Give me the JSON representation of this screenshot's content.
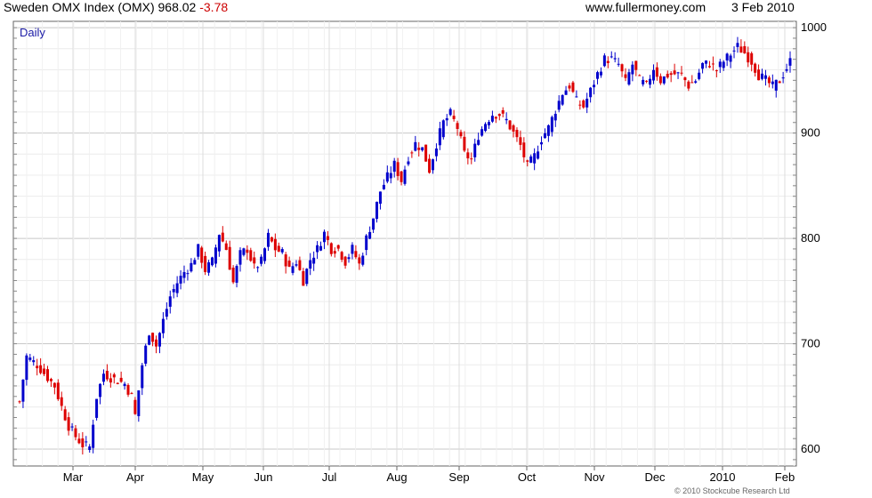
{
  "header": {
    "title": "Sweden OMX Index (OMX)",
    "last": "968.02",
    "change": "-3.78",
    "source": "www.fullermoney.com",
    "date": "3 Feb 2010"
  },
  "period_label": "Daily",
  "copyright": "© 2010 Stockcube Research Ltd",
  "colors": {
    "up": "#0000cc",
    "down": "#dd0000",
    "grid": "#dddddd",
    "frame": "#666666",
    "change": "#cc0000"
  },
  "chart_data": {
    "type": "ohlc",
    "y_axis": {
      "min": 584,
      "max": 1006,
      "ticks": [
        600,
        700,
        800,
        900,
        1000
      ],
      "position": "right"
    },
    "x_labels": [
      "Mar",
      "Apr",
      "May",
      "Jun",
      "Jul",
      "Aug",
      "Sep",
      "Oct",
      "Nov",
      "Dec",
      "2010",
      "Feb"
    ],
    "grid": true,
    "close_path": [
      [
        0,
        645
      ],
      [
        2,
        688
      ],
      [
        5,
        680
      ],
      [
        8,
        668
      ],
      [
        10,
        660
      ],
      [
        12,
        640
      ],
      [
        14,
        622
      ],
      [
        16,
        612
      ],
      [
        18,
        604
      ],
      [
        20,
        602
      ],
      [
        22,
        650
      ],
      [
        24,
        672
      ],
      [
        26,
        668
      ],
      [
        28,
        665
      ],
      [
        30,
        662
      ],
      [
        32,
        650
      ],
      [
        33,
        632
      ],
      [
        35,
        680
      ],
      [
        37,
        712
      ],
      [
        39,
        698
      ],
      [
        41,
        722
      ],
      [
        43,
        745
      ],
      [
        45,
        758
      ],
      [
        47,
        768
      ],
      [
        49,
        775
      ],
      [
        51,
        790
      ],
      [
        53,
        770
      ],
      [
        55,
        778
      ],
      [
        57,
        805
      ],
      [
        59,
        790
      ],
      [
        61,
        758
      ],
      [
        63,
        785
      ],
      [
        65,
        790
      ],
      [
        67,
        772
      ],
      [
        69,
        778
      ],
      [
        71,
        802
      ],
      [
        73,
        790
      ],
      [
        75,
        786
      ],
      [
        77,
        770
      ],
      [
        79,
        778
      ],
      [
        81,
        760
      ],
      [
        83,
        780
      ],
      [
        85,
        790
      ],
      [
        87,
        805
      ],
      [
        89,
        790
      ],
      [
        91,
        790
      ],
      [
        93,
        778
      ],
      [
        95,
        790
      ],
      [
        97,
        775
      ],
      [
        99,
        800
      ],
      [
        101,
        820
      ],
      [
        103,
        845
      ],
      [
        105,
        858
      ],
      [
        107,
        870
      ],
      [
        109,
        855
      ],
      [
        111,
        878
      ],
      [
        113,
        890
      ],
      [
        115,
        885
      ],
      [
        117,
        865
      ],
      [
        119,
        890
      ],
      [
        121,
        910
      ],
      [
        123,
        918
      ],
      [
        125,
        905
      ],
      [
        127,
        880
      ],
      [
        129,
        875
      ],
      [
        131,
        898
      ],
      [
        133,
        910
      ],
      [
        135,
        918
      ],
      [
        137,
        918
      ],
      [
        139,
        912
      ],
      [
        141,
        900
      ],
      [
        143,
        888
      ],
      [
        145,
        868
      ],
      [
        147,
        878
      ],
      [
        149,
        895
      ],
      [
        151,
        905
      ],
      [
        153,
        922
      ],
      [
        155,
        938
      ],
      [
        157,
        945
      ],
      [
        159,
        930
      ],
      [
        161,
        925
      ],
      [
        163,
        940
      ],
      [
        165,
        956
      ],
      [
        167,
        970
      ],
      [
        169,
        970
      ],
      [
        171,
        965
      ],
      [
        173,
        948
      ],
      [
        175,
        965
      ],
      [
        177,
        950
      ],
      [
        179,
        945
      ],
      [
        181,
        962
      ],
      [
        183,
        950
      ],
      [
        185,
        955
      ],
      [
        187,
        956
      ],
      [
        189,
        955
      ],
      [
        191,
        945
      ],
      [
        193,
        950
      ],
      [
        195,
        965
      ],
      [
        197,
        966
      ],
      [
        199,
        960
      ],
      [
        201,
        968
      ],
      [
        203,
        975
      ],
      [
        205,
        982
      ],
      [
        207,
        976
      ],
      [
        209,
        968
      ],
      [
        211,
        955
      ],
      [
        213,
        950
      ],
      [
        215,
        944
      ],
      [
        217,
        950
      ],
      [
        219,
        962
      ],
      [
        220,
        968
      ]
    ],
    "notes": "Daily candlesticks, Feb 2009 - 3 Feb 2010; blue = up day, red = down day"
  }
}
